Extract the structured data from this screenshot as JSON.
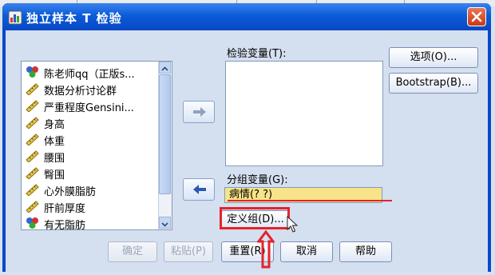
{
  "window": {
    "title": "独立样本 T 检验",
    "close_icon": "close-icon"
  },
  "variables": {
    "items": [
      {
        "label": "陈老师qq（正版s...",
        "icon": "nominal-icon"
      },
      {
        "label": "数据分析讨论群",
        "icon": "scale-icon"
      },
      {
        "label": "严重程度Gensini...",
        "icon": "scale-icon"
      },
      {
        "label": "身高",
        "icon": "scale-icon"
      },
      {
        "label": "体重",
        "icon": "scale-icon"
      },
      {
        "label": "腰围",
        "icon": "scale-icon"
      },
      {
        "label": "臀围",
        "icon": "scale-icon"
      },
      {
        "label": "心外膜脂肪",
        "icon": "scale-icon"
      },
      {
        "label": "肝前厚度",
        "icon": "scale-icon"
      },
      {
        "label": "有无脂肪",
        "icon": "nominal-icon"
      }
    ]
  },
  "test_variables": {
    "label": "检验变量(T):"
  },
  "grouping": {
    "label": "分组变量(G):",
    "value": "病情(? ?)",
    "define_button": "定义组(D)..."
  },
  "side_buttons": {
    "options": "选项(O)...",
    "bootstrap": "Bootstrap(B)..."
  },
  "bottom_buttons": {
    "ok": "确定",
    "paste": "粘贴(P)",
    "reset": "重置(R)",
    "cancel": "取消",
    "help": "帮助"
  },
  "colors": {
    "highlight": "#e3232b",
    "selected_field": "#f7e38a",
    "titlebar": "#0b5bd8"
  }
}
